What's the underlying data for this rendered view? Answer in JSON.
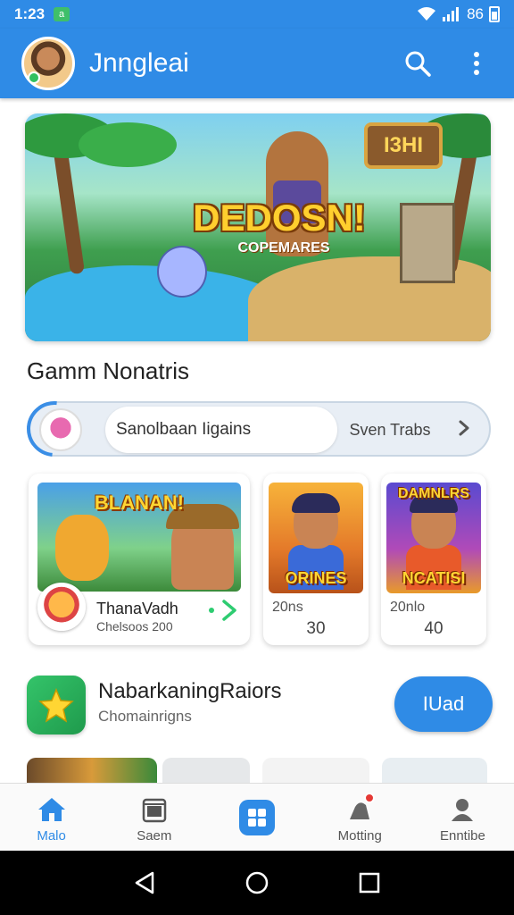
{
  "status_bar": {
    "time": "1:23",
    "sim_label": "a",
    "battery": "86"
  },
  "app_bar": {
    "title": "Jnngleai",
    "search_icon": "search-icon",
    "more_icon": "more-vert-icon"
  },
  "hero": {
    "headline": "DEDOSN!",
    "subline": "COPEMARES",
    "sign_text": "I3HI"
  },
  "section": {
    "title": "Gamm Nonatris"
  },
  "segmented": {
    "active_label": "Sanolbaan Iigains",
    "other_label": "Sven Trabs"
  },
  "cards": [
    {
      "art_text": "BLANAN!",
      "name": "ThanaVadh",
      "meta": "Chelsoos 200"
    },
    {
      "art_text": "ORINES",
      "line1": "20ns",
      "line2": "30"
    },
    {
      "art_text_top": "DAMNLRS",
      "art_text": "NCATISI",
      "line1": "20nlo",
      "line2": "40"
    }
  ],
  "app_row": {
    "name": "NabarkaningRaiors",
    "sub": "Chomainrigns",
    "button": "IUad"
  },
  "bottom_nav": [
    {
      "label": "Malo",
      "icon": "home-icon",
      "active": true
    },
    {
      "label": "Saem",
      "icon": "calendar-icon",
      "active": false
    },
    {
      "label": "",
      "icon": "grid-icon",
      "active": false
    },
    {
      "label": "Motting",
      "icon": "notification-icon",
      "active": false
    },
    {
      "label": "Enntibe",
      "icon": "profile-icon",
      "active": false
    }
  ],
  "colors": {
    "primary": "#2f8be6",
    "accent_green": "#34c46a",
    "badge_red": "#e53935"
  }
}
